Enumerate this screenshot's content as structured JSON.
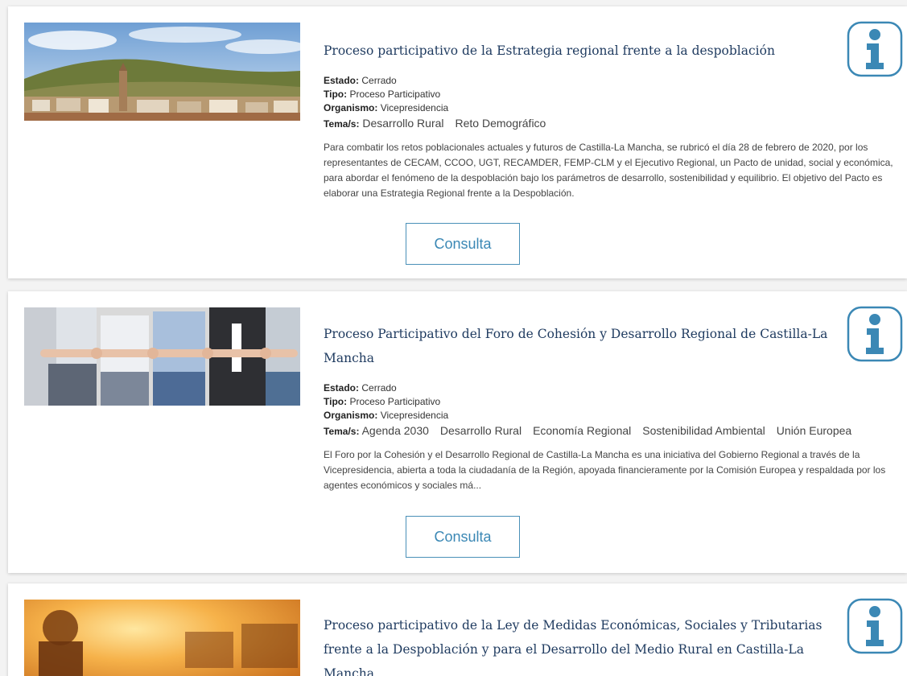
{
  "labels": {
    "estado": "Estado:",
    "tipo": "Tipo:",
    "organismo": "Organismo:",
    "temas": "Tema/s:"
  },
  "colors": {
    "title": "#1e3a5f",
    "accent": "#3b88b5",
    "card_bg": "#ffffff"
  },
  "cards": [
    {
      "image_icon": "village-landscape-photo",
      "title": "Proceso participativo de la Estrategia regional frente a la despoblación",
      "estado": "Cerrado",
      "tipo": "Proceso Participativo",
      "organismo": "Vicepresidencia",
      "temas": [
        "Desarrollo Rural",
        "Reto Demográfico"
      ],
      "description": "Para combatir los retos poblacionales actuales y futuros de Castilla-La Mancha, se rubricó el día 28 de febrero de 2020, por los representantes de CECAM, CCOO, UGT, RECAMDER, FEMP-CLM y el Ejecutivo Regional, un Pacto de unidad, social y económica, para abordar el fenómeno de la despoblación bajo los parámetros de desarrollo, sostenibilidad y equilibrio. El objetivo del Pacto es elaborar una Estrategia Regional frente a la Despoblación.",
      "button_label": "Consulta",
      "info_icon": "info-icon"
    },
    {
      "image_icon": "people-holding-arms-photo",
      "title": "Proceso Participativo del Foro de Cohesión y Desarrollo Regional de Castilla-La Mancha",
      "estado": "Cerrado",
      "tipo": "Proceso Participativo",
      "organismo": "Vicepresidencia",
      "temas": [
        "Agenda 2030",
        "Desarrollo Rural",
        "Economía Regional",
        "Sostenibilidad Ambiental",
        "Unión Europea"
      ],
      "description": "El Foro por la Cohesión y el Desarrollo Regional de Castilla-La Mancha es una iniciativa del Gobierno Regional a través de la Vicepresidencia, abierta a toda la ciudadanía de la Región, apoyada financieramente por la Comisión Europea y respaldada por los agentes económicos y sociales má...",
      "button_label": "Consulta",
      "info_icon": "info-icon"
    },
    {
      "image_icon": "sunset-rural-photo",
      "title": "Proceso participativo de la Ley de Medidas Económicas, Sociales y Tributarias frente a la Despoblación y para el Desarrollo del Medio Rural en Castilla-La Mancha",
      "info_icon": "info-icon"
    }
  ]
}
